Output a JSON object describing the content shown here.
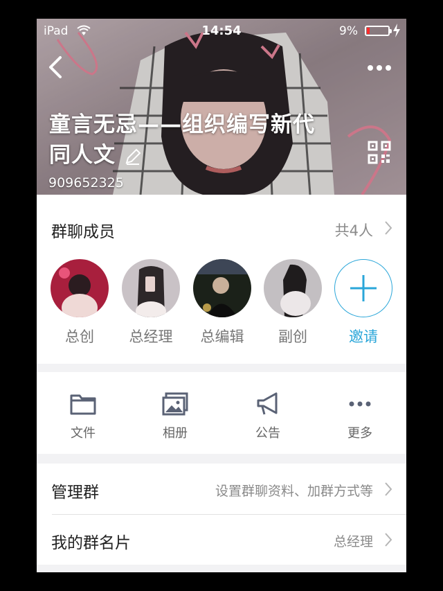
{
  "status_bar": {
    "carrier": "iPad",
    "time": "14:54",
    "battery": "9%"
  },
  "header": {
    "title": "童言无忌——组织编写新代同人文",
    "group_id": "909652325"
  },
  "members": {
    "label": "群聊成员",
    "count": "共4人",
    "list": [
      {
        "role": "总创"
      },
      {
        "role": "总经理"
      },
      {
        "role": "总编辑"
      },
      {
        "role": "副创"
      }
    ],
    "invite_label": "邀请"
  },
  "actions": [
    {
      "label": "文件",
      "icon": "folder-icon"
    },
    {
      "label": "相册",
      "icon": "album-icon"
    },
    {
      "label": "公告",
      "icon": "megaphone-icon"
    },
    {
      "label": "更多",
      "icon": "more-dots-icon"
    }
  ],
  "settings": [
    {
      "label": "管理群",
      "value": "设置群聊资料、加群方式等"
    },
    {
      "label": "我的群名片",
      "value": "总经理"
    }
  ],
  "colors": {
    "accent": "#2aa6d9",
    "text": "#222222",
    "secondary": "#8a8a8a",
    "background": "#f2f2f4"
  }
}
